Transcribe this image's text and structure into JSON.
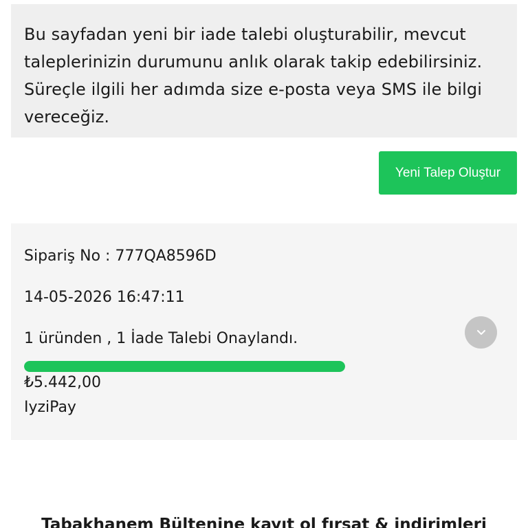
{
  "info": {
    "text": "Bu sayfadan yeni bir iade talebi oluşturabilir, mevcut taleplerinizin durumunu anlık olarak takip edebilirsiniz. Süreçle ilgili her adımda size e-posta veya SMS ile bilgi vereceğiz."
  },
  "actions": {
    "new_request_label": "Yeni Talep Oluştur"
  },
  "order": {
    "order_no_text": "Sipariş No : 777QA8596D",
    "date_text": "14-05-2026 16:47:11",
    "status_text": "1 üründen , 1 İade Talebi Onaylandı.",
    "progress": 1.0,
    "price_text": "₺5.442,00",
    "payment_method": "IyziPay",
    "expand_icon": "chevron-down-icon"
  },
  "newsletter": {
    "title": "Tabakhanem Bültenine kayıt ol fırsat & indirimleri"
  },
  "colors": {
    "accent_green": "#1dc45a",
    "info_bg": "#efefef",
    "card_bg": "#f5f5f5",
    "toggle_bg": "#c5c5c5"
  }
}
